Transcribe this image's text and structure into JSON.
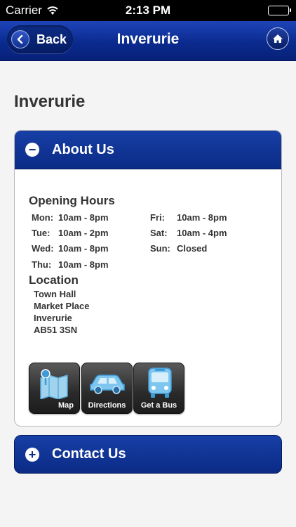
{
  "status_bar": {
    "carrier": "Carrier",
    "time": "2:13 PM"
  },
  "nav": {
    "back_label": "Back",
    "title": "Inverurie"
  },
  "page": {
    "heading": "Inverurie"
  },
  "about": {
    "title": "About Us",
    "toggle": "−",
    "opening_hours_title": "Opening Hours",
    "hours": [
      {
        "day": "Mon:",
        "time": "10am - 8pm"
      },
      {
        "day": "Tue:",
        "time": "10am - 2pm"
      },
      {
        "day": "Wed:",
        "time": "10am - 8pm"
      },
      {
        "day": "Thu:",
        "time": "10am - 8pm"
      },
      {
        "day": "Fri:",
        "time": "10am - 8pm"
      },
      {
        "day": "Sat:",
        "time": "10am - 4pm"
      },
      {
        "day": "Sun:",
        "time": "Closed"
      }
    ],
    "location_title": "Location",
    "address": [
      "Town Hall",
      "Market Place",
      "Inverurie",
      "AB51 3SN"
    ],
    "actions": [
      {
        "label": "Map",
        "icon": "map-icon"
      },
      {
        "label": "Directions",
        "icon": "car-icon"
      },
      {
        "label": "Get a Bus",
        "icon": "bus-icon"
      }
    ]
  },
  "contact": {
    "title": "Contact Us",
    "toggle": "+"
  },
  "colors": {
    "nav_blue": "#0a2a8e",
    "panel_header_blue": "#0b2b86",
    "tile_dark": "#2a2a2a"
  }
}
